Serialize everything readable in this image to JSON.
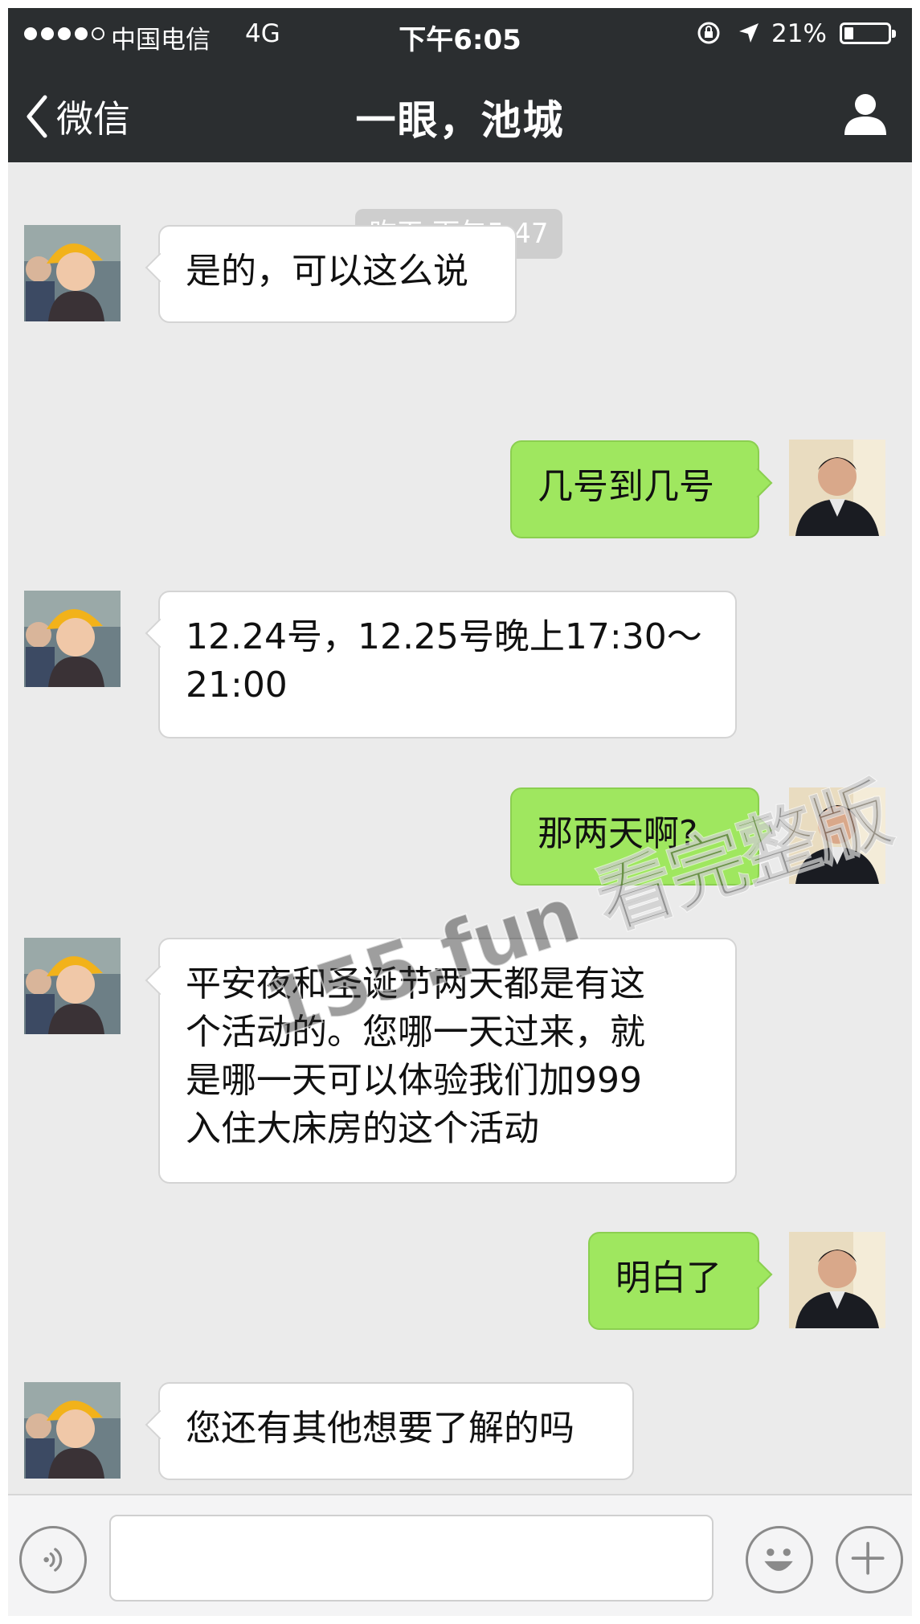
{
  "status_bar": {
    "carrier": "中国电信",
    "network": "4G",
    "time": "下午6:05",
    "battery": "21%",
    "battery_level": 0.21
  },
  "nav": {
    "back_label": "微信",
    "title": "一眼，池城"
  },
  "chat": {
    "timestamp": "昨天 下午5:47",
    "messages": [
      {
        "side": "in",
        "text": "是的，可以这么说"
      },
      {
        "side": "out",
        "text": "几号到几号"
      },
      {
        "side": "in",
        "text": "12.24号，12.25号晚上17:30～\n21:00"
      },
      {
        "side": "out",
        "text": "那两天啊?"
      },
      {
        "side": "in",
        "text": "平安夜和圣诞节两天都是有这\n个活动的。您哪一天过来，就\n是哪一天可以体验我们加999\n入住大床房的这个活动"
      },
      {
        "side": "out",
        "text": "明白了"
      },
      {
        "side": "in",
        "text": "您还有其他想要了解的吗"
      }
    ]
  },
  "watermark": "155.fun 看完整版",
  "icons": {
    "back": "chevron-left-icon",
    "profile": "person-icon",
    "voice": "voice-icon",
    "emoji": "smiley-icon",
    "plus": "plus-icon"
  },
  "colors": {
    "topbar": "#2b2e30",
    "chat_bg": "#ebebeb",
    "outgoing_bubble": "#9fe75f",
    "incoming_bubble": "#ffffff"
  }
}
